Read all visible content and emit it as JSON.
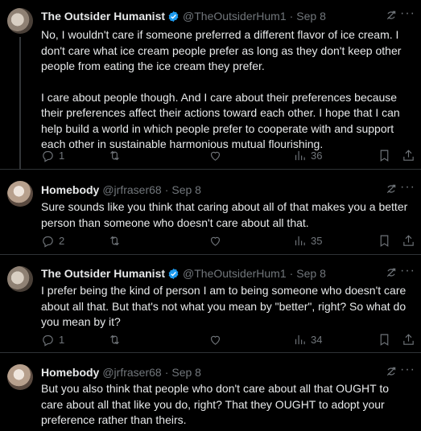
{
  "tweets": [
    {
      "name": "The Outsider Humanist",
      "verified": true,
      "handle": "@TheOutsiderHum1",
      "time": "Sep 8",
      "paragraphs": [
        "No, I wouldn't care if someone preferred a different flavor of ice cream. I don't care what ice cream people prefer as long as they don't keep other people from eating the ice cream they prefer.",
        "I care about people though. And I care about their preferences because their preferences affect their actions toward each other. I hope that I can help build a world in which people prefer to cooperate with and support each other in sustainable harmonious mutual flourishing."
      ],
      "replies": "1",
      "retweets": "",
      "likes": "",
      "views": "36"
    },
    {
      "name": "Homebody",
      "verified": false,
      "handle": "@jrfraser68",
      "time": "Sep 8",
      "paragraphs": [
        "Sure sounds like you think that caring about all of that makes you a better person than someone who doesn't care about all that."
      ],
      "replies": "2",
      "retweets": "",
      "likes": "",
      "views": "35"
    },
    {
      "name": "The Outsider Humanist",
      "verified": true,
      "handle": "@TheOutsiderHum1",
      "time": "Sep 8",
      "paragraphs": [
        "I prefer being the kind of person I am to being someone who doesn't care about all that. But that's not what you mean by \"better\", right? So what do you mean by it?"
      ],
      "replies": "1",
      "retweets": "",
      "likes": "",
      "views": "34"
    },
    {
      "name": "Homebody",
      "verified": false,
      "handle": "@jrfraser68",
      "time": "Sep 8",
      "paragraphs": [
        "But you also think that people who don't care about all that OUGHT to care about all that like you do, right? That they OUGHT to adopt your preference rather than theirs."
      ]
    }
  ],
  "icons": {
    "reply": "reply-icon",
    "retweet": "retweet-icon",
    "like": "heart-icon",
    "views": "views-icon",
    "bookmark": "bookmark-icon",
    "share": "share-icon",
    "grok": "grok-icon",
    "more": "more-icon"
  },
  "colors": {
    "background": "#000000",
    "text": "#e7e9ea",
    "muted": "#71767b",
    "verified": "#1d9bf0",
    "divider": "#2f3336"
  },
  "separator": "·",
  "more_glyph": "···"
}
